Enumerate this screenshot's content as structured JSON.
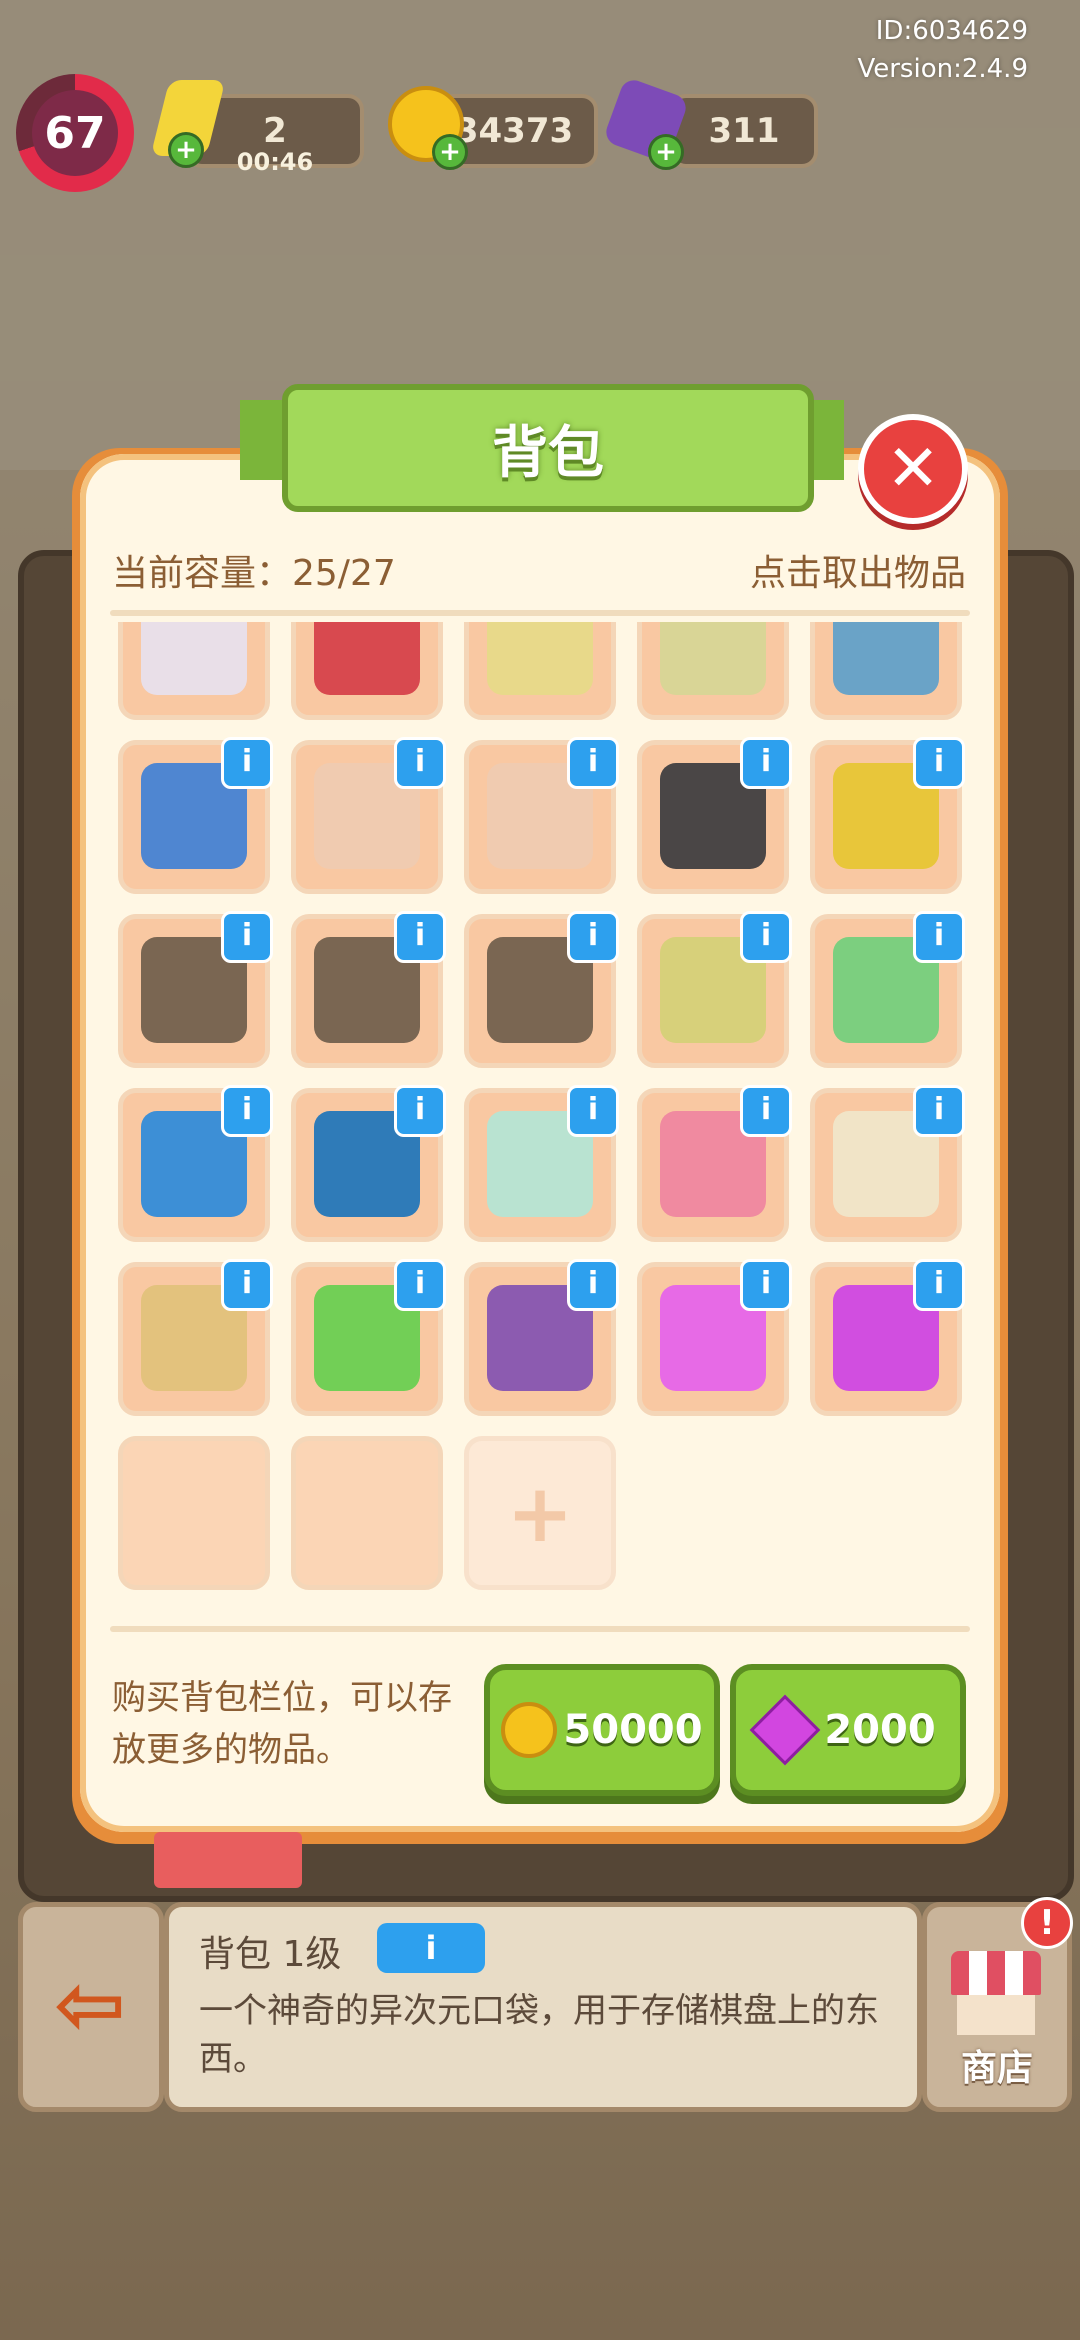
{
  "hud": {
    "player_id": "ID:6034629",
    "version": "Version:2.4.9",
    "level": "67",
    "energy": "2",
    "energy_timer": "00:46",
    "coins": "34373",
    "gems": "311"
  },
  "modal": {
    "title": "背包",
    "capacity_label": "当前容量：25/27",
    "hint": "点击取出物品",
    "info_badge": "i",
    "add_symbol": "+",
    "close_symbol": "✕",
    "items": [
      {
        "icon": "paint-box-icon",
        "color": "#e9dfe8",
        "info": false
      },
      {
        "icon": "red-basket-icon",
        "color": "#d8494f",
        "info": false
      },
      {
        "icon": "yellow-tray-icon",
        "color": "#e8d98a",
        "info": false
      },
      {
        "icon": "yellow-trays-icon",
        "color": "#d9d596",
        "info": false
      },
      {
        "icon": "exercise-bike-icon",
        "color": "#6aa3c7",
        "info": false
      },
      {
        "icon": "duck-book-icon",
        "color": "#4f86d1",
        "info": true
      },
      {
        "icon": "certificate-book-icon",
        "color": "#f0cbb0",
        "info": true
      },
      {
        "icon": "certificate-book-icon",
        "color": "#f0cbb0",
        "info": true
      },
      {
        "icon": "skateboard-wheels-icon",
        "color": "#4a4646",
        "info": true
      },
      {
        "icon": "shopping-cart-icon",
        "color": "#e8c63a",
        "info": true
      },
      {
        "icon": "locker-cabinet-icon",
        "color": "#7a6652",
        "info": true
      },
      {
        "icon": "locker-cabinet-icon",
        "color": "#7a6652",
        "info": true
      },
      {
        "icon": "locker-cabinet-icon",
        "color": "#7a6652",
        "info": true
      },
      {
        "icon": "fabric-scissors-icon",
        "color": "#d7d07a",
        "info": true
      },
      {
        "icon": "cash-stack-icon",
        "color": "#7ccf7f",
        "info": true
      },
      {
        "icon": "cpu-chip-icon",
        "color": "#3d8fd6",
        "info": true
      },
      {
        "icon": "circuit-board-icon",
        "color": "#2f7bb8",
        "info": true
      },
      {
        "icon": "craft-table-icon",
        "color": "#b9e3d1",
        "info": true
      },
      {
        "icon": "origami-butterfly-icon",
        "color": "#f08aa0",
        "info": true
      },
      {
        "icon": "piggy-bank-icon",
        "color": "#f1e4c7",
        "info": true
      },
      {
        "icon": "paint-bucket-box-icon",
        "color": "#e3c27d",
        "info": true
      },
      {
        "icon": "upgrade-card-icon",
        "color": "#72cf56",
        "info": true
      },
      {
        "icon": "coin-bag-icon",
        "color": "#8c5bb0",
        "info": true
      },
      {
        "icon": "pink-gem-icon",
        "color": "#e76ae6",
        "info": true
      },
      {
        "icon": "gem-pile-icon",
        "color": "#d14ee0",
        "info": true
      },
      {
        "icon": "",
        "color": "",
        "info": false,
        "empty": true
      },
      {
        "icon": "",
        "color": "",
        "info": false,
        "empty": true
      },
      {
        "icon": "",
        "color": "",
        "info": false,
        "add": true
      }
    ],
    "buy_text": "购买背包栏位，可以存放更多的物品。",
    "buy_coin_price": "50000",
    "buy_gem_price": "2000"
  },
  "info_panel": {
    "title": "背包 1级",
    "info_badge": "i",
    "description": "一个神奇的异次元口袋，用于存储棋盘上的东西。",
    "shop_label": "商店",
    "shop_alert": "!",
    "exit_symbol": "⇦"
  },
  "colors": {
    "accent_green": "#8dcd3b",
    "close_red": "#e8413f",
    "info_blue": "#2da0ee",
    "text_brown": "#8b5e34"
  }
}
